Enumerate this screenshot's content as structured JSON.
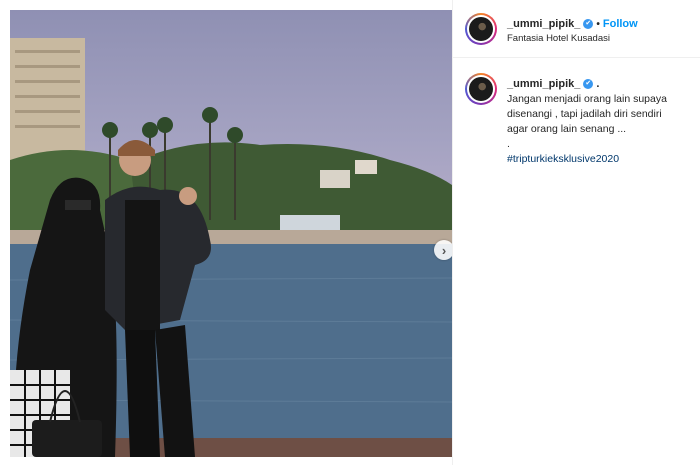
{
  "post": {
    "username": "_ummi_pipik_",
    "follow_label": "Follow",
    "location": "Fantasia Hotel Kusadasi",
    "separator": "•",
    "verified_glyph": "✔",
    "caption": {
      "trailing": ".",
      "lines": [
        "Jangan menjadi orang lain supaya",
        "disenangi , tapi jadilah diri sendiri",
        "agar orang lain senang ...",
        "."
      ],
      "hashtag": "#tripturkieksklusive2020"
    },
    "next_arrow": "›",
    "icons": {
      "verified": "verified-badge-icon",
      "next": "chevron-right-icon"
    },
    "colors": {
      "accent": "#0095f6",
      "hashtag": "#00376b",
      "verified": "#3897f0"
    }
  }
}
